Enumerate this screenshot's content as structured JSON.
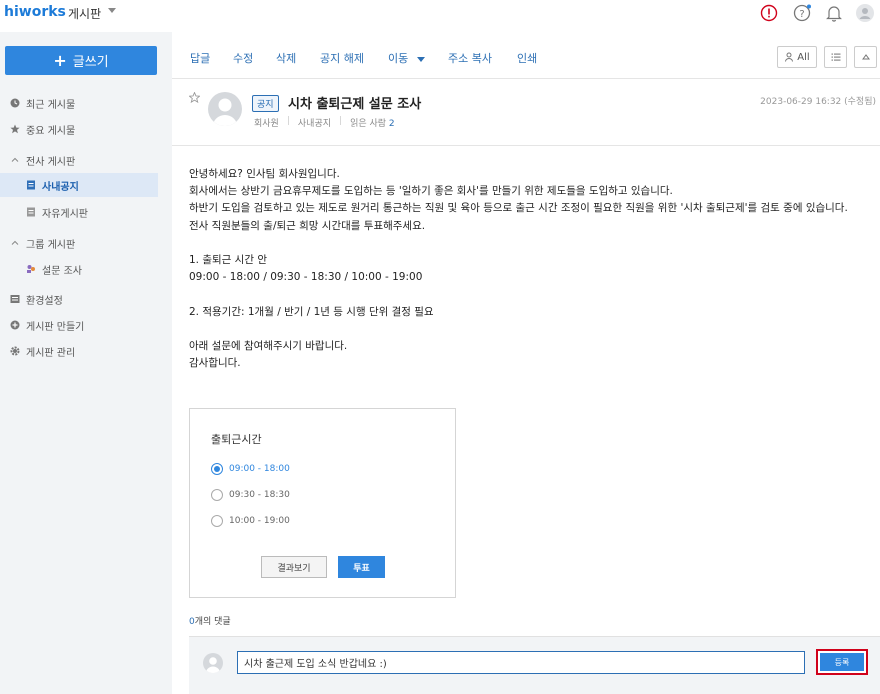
{
  "app": {
    "logo": "hiworks",
    "name": "게시판"
  },
  "sidebar": {
    "write_label": "글쓰기",
    "items": [
      {
        "label": "최근 게시물",
        "icon": "clock-icon"
      },
      {
        "label": "중요 게시물",
        "icon": "star-icon"
      },
      {
        "label": "전사 게시판",
        "icon": "chevron-up-icon"
      },
      {
        "label": "사내공지",
        "icon": "board-icon"
      },
      {
        "label": "자유게시판",
        "icon": "board-icon"
      },
      {
        "label": "그룹 게시판",
        "icon": "chevron-up-icon"
      },
      {
        "label": "설문 조사",
        "icon": "users-icon"
      },
      {
        "label": "환경설정",
        "icon": "settings-icon"
      },
      {
        "label": "게시판 만들기",
        "icon": "plus-circle-icon"
      },
      {
        "label": "게시판 관리",
        "icon": "gear-icon"
      }
    ]
  },
  "toolbar": {
    "actions": [
      "답글",
      "수정",
      "삭제",
      "공지 해제",
      "이동",
      "주소 복사",
      "인쇄"
    ],
    "all_label": "All"
  },
  "post": {
    "badge": "공지",
    "title": "시차 출퇴근제 설문 조사",
    "author": "회사원",
    "board": "사내공지",
    "readers_label": "읽은 사람",
    "readers_count": "2",
    "date": "2023-06-29 16:32 (수정됨)",
    "body": "안녕하세요? 인사팀 회사원입니다.\n회사에서는 상반기 금요휴무제도를 도입하는 등 '일하기 좋은 회사'를 만들기 위한 제도들을 도입하고 있습니다.\n하반기 도입을 검토하고 있는 제도로 원거리 통근하는 직원 및 육아 등으로 출근 시간 조정이 필요한 직원을 위한 '시차 출퇴근제'를 검토 중에 있습니다.\n전사 직원분들의 출/퇴근 희망 시간대를 투표해주세요.\n\n1. 출퇴근 시간 안\n09:00 - 18:00 / 09:30 - 18:30 / 10:00 - 19:00\n\n2. 적용기간: 1개월 / 반기 / 1년 등 시행 단위 결정 필요\n\n아래 설문에 참여해주시기 바랍니다.\n감사합니다."
  },
  "poll": {
    "title": "출퇴근시간",
    "options": [
      "09:00 - 18:00",
      "09:30 - 18:30",
      "10:00 - 19:00"
    ],
    "selected_index": 0,
    "result_label": "결과보기",
    "vote_label": "투표"
  },
  "comments": {
    "count": "0",
    "count_suffix": "개의 댓글",
    "input_value": "시차 출근제 도입 소식 반갑네요 :)",
    "submit_label": "등록"
  }
}
